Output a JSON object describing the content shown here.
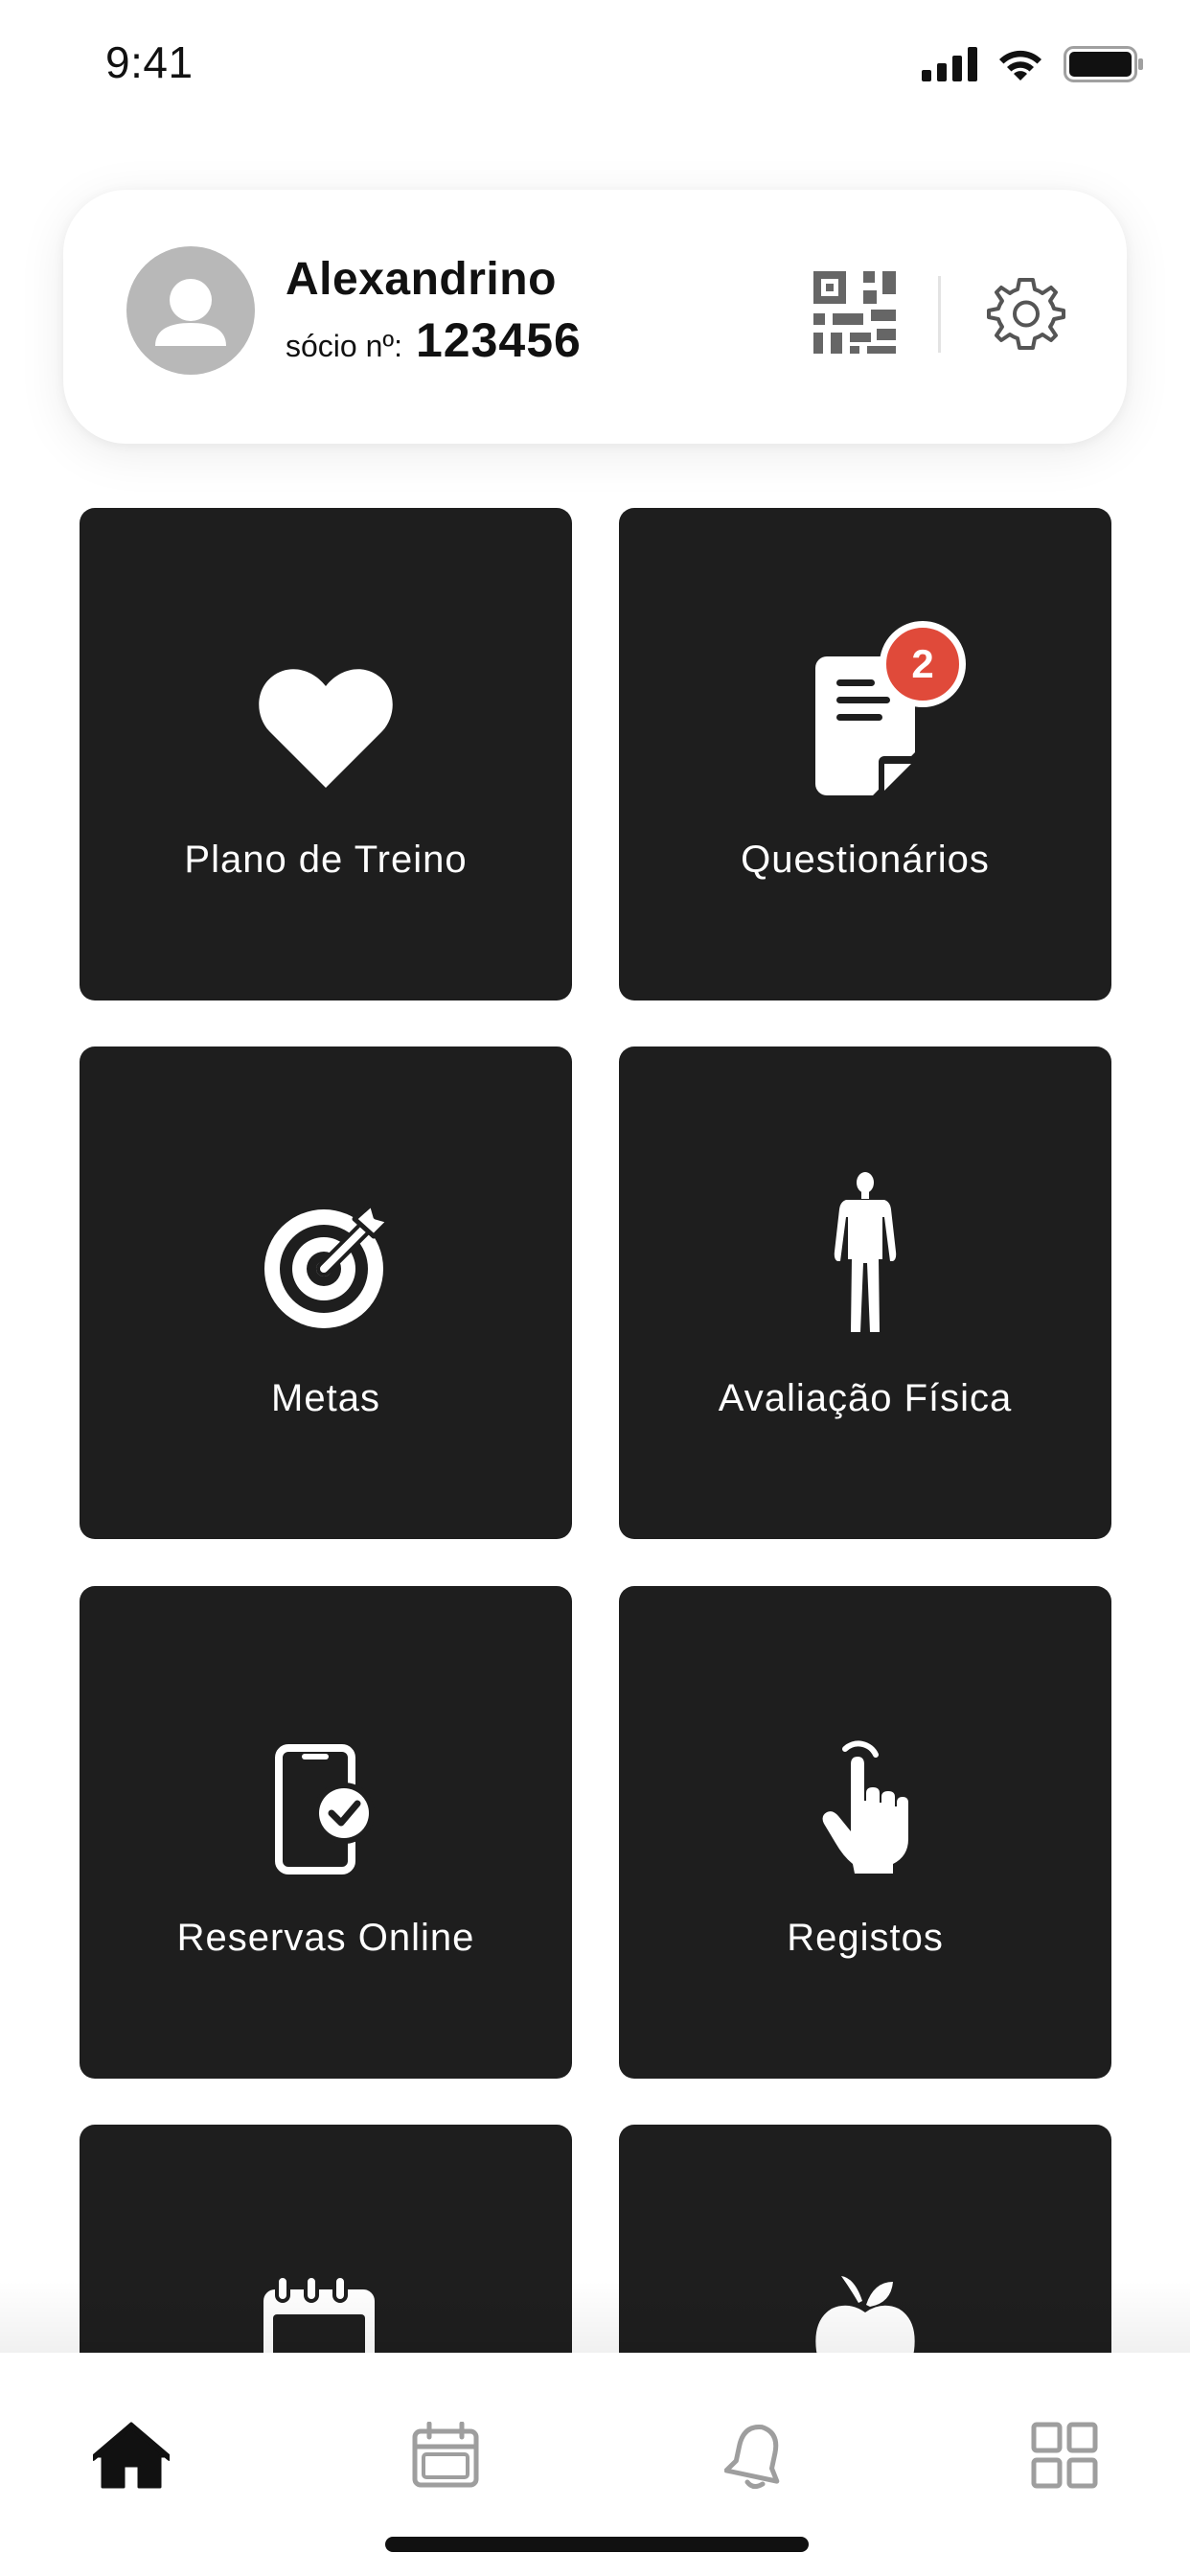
{
  "status_bar": {
    "time": "9:41",
    "icons": [
      "cellular-signal-icon",
      "wifi-icon",
      "battery-icon"
    ]
  },
  "profile": {
    "name": "Alexandrino",
    "member_label": "sócio nº:",
    "member_number": "123456",
    "icons": [
      "avatar-person-icon",
      "qr-code-icon",
      "gear-icon"
    ]
  },
  "tiles": [
    {
      "label": "Plano de Treino",
      "icon": "heart-icon"
    },
    {
      "label": "Questionários",
      "icon": "document-icon",
      "badge": "2"
    },
    {
      "label": "Metas",
      "icon": "target-icon"
    },
    {
      "label": "Avaliação Física",
      "icon": "human-body-icon"
    },
    {
      "label": "Reservas Online",
      "icon": "phone-check-icon"
    },
    {
      "label": "Registos",
      "icon": "hand-pointer-icon"
    },
    {
      "label": "",
      "icon": "calendar-clock-icon"
    },
    {
      "label": "",
      "icon": "apple-icon"
    }
  ],
  "tab_bar": {
    "items": [
      {
        "icon": "home-icon",
        "active": true
      },
      {
        "icon": "calendar-icon",
        "active": false
      },
      {
        "icon": "bell-icon",
        "active": false
      },
      {
        "icon": "grid-icon",
        "active": false
      }
    ]
  },
  "colors": {
    "tile_background": "#1e1e1e",
    "badge": "#e04a3a",
    "avatar": "#b8b8b8",
    "inactive_icon": "#9e9e9e"
  }
}
